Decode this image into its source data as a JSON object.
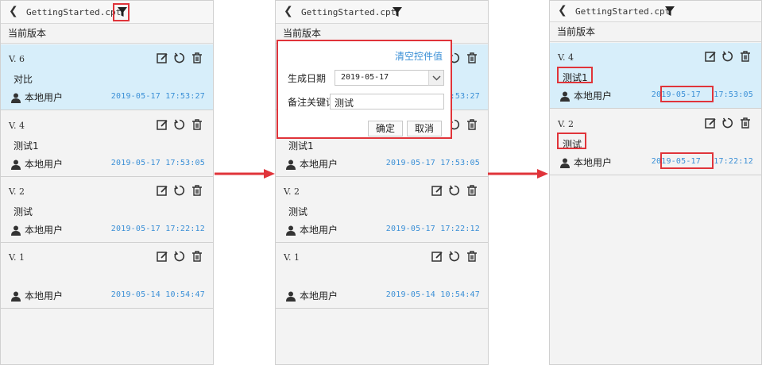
{
  "screens": [
    {
      "title": "GettingStarted.cpt",
      "section": "当前版本",
      "versions": [
        {
          "label": "V. 6",
          "note": "对比",
          "user": "本地用户",
          "time": "2019-05-17  17:53:27"
        },
        {
          "label": "V. 4",
          "note": "测试1",
          "user": "本地用户",
          "time": "2019-05-17  17:53:05"
        },
        {
          "label": "V. 2",
          "note": "测试",
          "user": "本地用户",
          "time": "2019-05-17  17:22:12"
        },
        {
          "label": "V. 1",
          "note": "",
          "user": "本地用户",
          "time": "2019-05-14  10:54:47"
        }
      ]
    },
    {
      "title": "GettingStarted.cpt",
      "section": "当前版本",
      "versions": [
        {
          "label": "",
          "note": "",
          "user": "",
          "time": "17:53:27"
        },
        {
          "label": "",
          "note": "测试1",
          "user": "本地用户",
          "time": "2019-05-17  17:53:05"
        },
        {
          "label": "V. 2",
          "note": "测试",
          "user": "本地用户",
          "time": "2019-05-17  17:22:12"
        },
        {
          "label": "V. 1",
          "note": "",
          "user": "本地用户",
          "time": "2019-05-14  10:54:47"
        }
      ],
      "filter": {
        "clear_label": "清空控件值",
        "date_label": "生成日期",
        "date_value": "2019-05-17",
        "keyword_label": "备注关键词",
        "keyword_value": "测试",
        "ok_label": "确定",
        "cancel_label": "取消"
      }
    },
    {
      "title": "GettingStarted.cpt",
      "section": "当前版本",
      "versions": [
        {
          "label": "V. 4",
          "note": "测试1",
          "user": "本地用户",
          "date": "2019-05-17",
          "clock": "17:53:05"
        },
        {
          "label": "V. 2",
          "note": "测试",
          "user": "本地用户",
          "date": "2019-05-17",
          "clock": "17:22:12"
        }
      ]
    }
  ],
  "colors": {
    "highlight": "#e0343a",
    "accent": "#3a8fd6",
    "active_row": "#d7eefa"
  }
}
